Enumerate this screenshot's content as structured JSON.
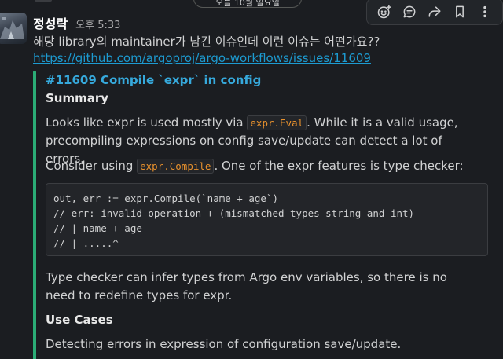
{
  "top_pill": {
    "label": "오늘 10월 일요일"
  },
  "toolbar": {
    "icons": [
      "add-reaction-icon",
      "reply-thread-icon",
      "share-icon",
      "bookmark-icon",
      "more-actions-icon"
    ]
  },
  "message": {
    "author": "정성락",
    "time": "오후 5:33",
    "text": "해당 library의 maintainer가 남긴 이슈인데 이런 이슈는 어떤가요??",
    "link": "https://github.com/argoproj/argo-workflows/issues/11609"
  },
  "unfurl": {
    "accent": "#2bac76",
    "title": "#11609 Compile `expr` in config",
    "summary_heading": "Summary",
    "p1_before": "Looks like expr is used mostly via ",
    "p1_code": "expr.Eval",
    "p1_after": ". While it is a valid usage, precompiling expressions on config save/update can detect a lot of errors.",
    "p2_before": "Consider using ",
    "p2_code": "expr.Compile",
    "p2_after": ". One of the expr features is type checker:",
    "code_lines": [
      "out, err := expr.Compile(`name + age`)",
      "// err: invalid operation + (mismatched types string and int)",
      "// | name + age",
      "// | .....^"
    ],
    "p3": "Type checker can infer types from Argo env variables, so there is no need to redefine types for expr.",
    "usecases_heading": "Use Cases",
    "p4": "Detecting errors in expression of configuration save/update."
  }
}
